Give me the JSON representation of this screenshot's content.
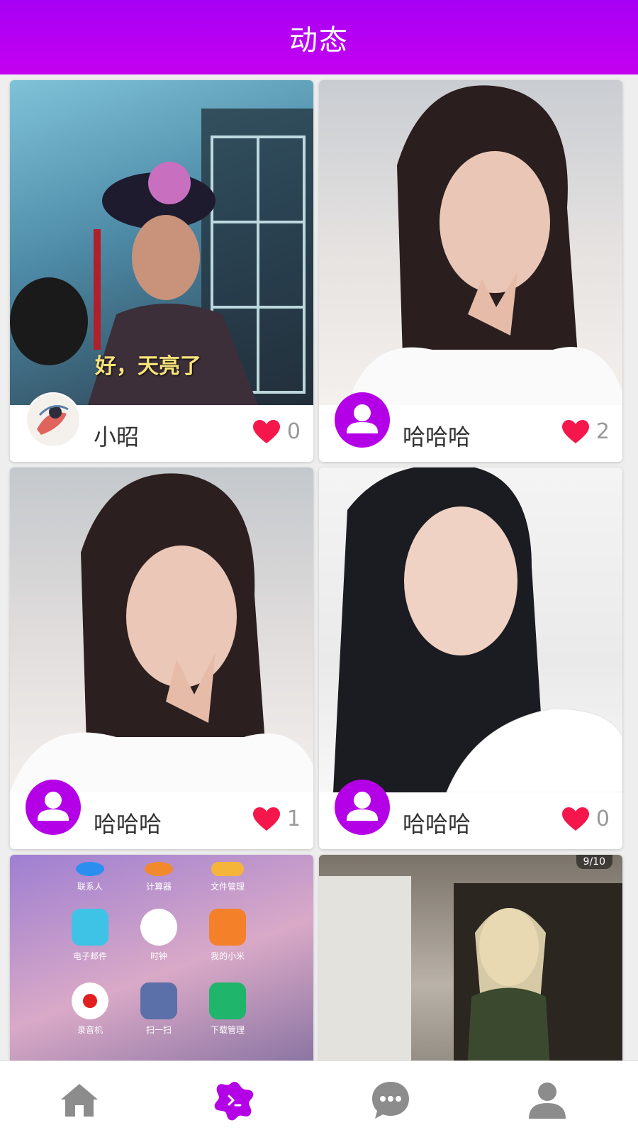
{
  "header": {
    "title": "动态"
  },
  "cards": [
    {
      "username": "小昭",
      "likes": "0",
      "avatar": "photo",
      "thumb_caption": "好，天亮了"
    },
    {
      "username": "哈哈哈",
      "likes": "2",
      "avatar": "default-user-icon"
    },
    {
      "username": "哈哈哈",
      "likes": "1",
      "avatar": "default-user-icon"
    },
    {
      "username": "哈哈哈",
      "likes": "0",
      "avatar": "default-user-icon"
    }
  ],
  "partial_cards": {
    "left_home_apps": [
      {
        "label": "联系人"
      },
      {
        "label": "计算器"
      },
      {
        "label": "文件管理"
      },
      {
        "label": "电子邮件"
      },
      {
        "label": "时钟"
      },
      {
        "label": "我的小米"
      },
      {
        "label": "录音机"
      },
      {
        "label": "扫一扫"
      },
      {
        "label": "下载管理"
      }
    ],
    "right_counter": "9/10"
  },
  "tabbar": {
    "tabs": [
      {
        "icon": "home-icon",
        "active": false
      },
      {
        "icon": "video-flower-icon",
        "active": true
      },
      {
        "icon": "chat-bubble-icon",
        "active": false
      },
      {
        "icon": "person-icon",
        "active": false
      }
    ]
  },
  "colors": {
    "header_gradient_top": "#a700f5",
    "header_gradient_bottom": "#c400f0",
    "avatar_purple": "#b400e6",
    "like_heart": "#f5174b",
    "tab_active": "#b400e6",
    "tab_inactive": "#8c8c8c"
  }
}
